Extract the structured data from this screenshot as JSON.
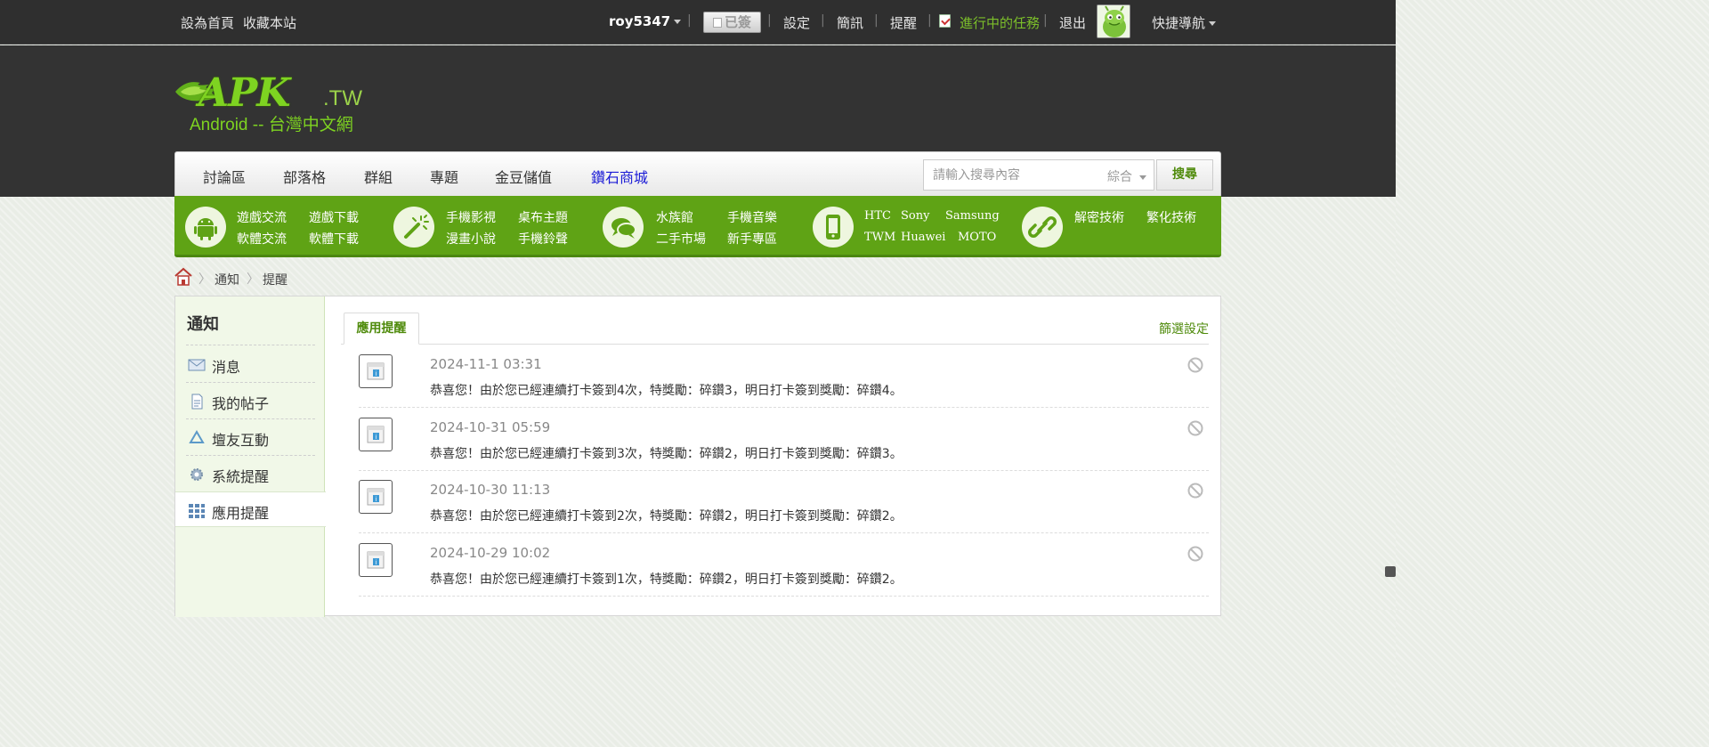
{
  "topbar": {
    "set_home": "設為首頁",
    "bookmark": "收藏本站",
    "username": "roy5347",
    "signed": "已簽",
    "settings": "設定",
    "messages": "簡訊",
    "reminders": "提醒",
    "tasks": "進行中的任務",
    "logout": "退出",
    "quick_nav": "快捷導航"
  },
  "logo": {
    "main": "APK",
    "tld": ".TW",
    "sub": "Android -- 台灣中文網"
  },
  "mainnav": {
    "items": [
      "討論區",
      "部落格",
      "群組",
      "專題",
      "金豆儲值",
      "鑽石商城"
    ],
    "search_placeholder": "請輸入搜尋內容",
    "search_type": "綜合",
    "search_button": "搜尋"
  },
  "categories": [
    {
      "icon": "android-icon",
      "links": [
        "遊戲交流",
        "遊戲下載",
        "軟體交流",
        "軟體下載"
      ]
    },
    {
      "icon": "magic-wand-icon",
      "links": [
        "手機影視",
        "桌布主題",
        "漫畫小說",
        "手機鈴聲"
      ]
    },
    {
      "icon": "chat-bubble-icon",
      "links": [
        "水族館",
        "手機音樂",
        "二手市場",
        "新手專區"
      ]
    },
    {
      "icon": "phone-icon",
      "links": [
        "HTC",
        "Sony",
        "Samsung",
        "TWM",
        "Huawei",
        "MOTO"
      ]
    },
    {
      "icon": "link-icon",
      "links": [
        "解密技術",
        "繁化技術"
      ]
    }
  ],
  "breadcrumb": [
    "通知",
    "提醒"
  ],
  "sidebar": {
    "title": "通知",
    "items": [
      {
        "label": "消息",
        "icon": "envelope-icon"
      },
      {
        "label": "我的帖子",
        "icon": "document-icon"
      },
      {
        "label": "壇友互動",
        "icon": "recycle-icon"
      },
      {
        "label": "系統提醒",
        "icon": "gear-icon"
      },
      {
        "label": "應用提醒",
        "icon": "apps-grid-icon",
        "active": true
      }
    ]
  },
  "content": {
    "tab": "應用提醒",
    "filter": "篩選設定",
    "notices": [
      {
        "date": "2024-11-1 03:31",
        "text": "恭喜您！由於您已經連續打卡簽到4次，特獎勵：碎鑽3，明日打卡簽到獎勵：碎鑽4。"
      },
      {
        "date": "2024-10-31 05:59",
        "text": "恭喜您！由於您已經連續打卡簽到3次，特獎勵：碎鑽2，明日打卡簽到獎勵：碎鑽3。"
      },
      {
        "date": "2024-10-30 11:13",
        "text": "恭喜您！由於您已經連續打卡簽到2次，特獎勵：碎鑽2，明日打卡簽到獎勵：碎鑽2。"
      },
      {
        "date": "2024-10-29 10:02",
        "text": "恭喜您！由於您已經連續打卡簽到1次，特獎勵：碎鑽2，明日打卡簽到獎勵：碎鑽2。"
      }
    ]
  },
  "colors": {
    "accent_green": "#5fa315",
    "link_green": "#4e8a0a",
    "diamond_blue": "#1a1ad6",
    "topbar_bg": "#2f2f2f"
  }
}
